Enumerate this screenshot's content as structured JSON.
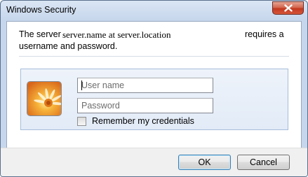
{
  "window": {
    "title": "Windows Security"
  },
  "message": {
    "part1": "The server",
    "server_name": "server.name at server.location",
    "part2": "requires a",
    "line2": "username and password."
  },
  "credentials": {
    "username_placeholder": "User name",
    "password_placeholder": "Password",
    "remember_label": "Remember my credentials",
    "remember_checked": false,
    "user_tile_icon": "user-tile-flower-icon"
  },
  "buttons": {
    "ok_label": "OK",
    "cancel_label": "Cancel"
  },
  "colors": {
    "title_bar": "#c6d6ec",
    "close_button": "#c2371f",
    "panel_border": "#a7bcd9",
    "default_button_border": "#3c7fb1"
  }
}
